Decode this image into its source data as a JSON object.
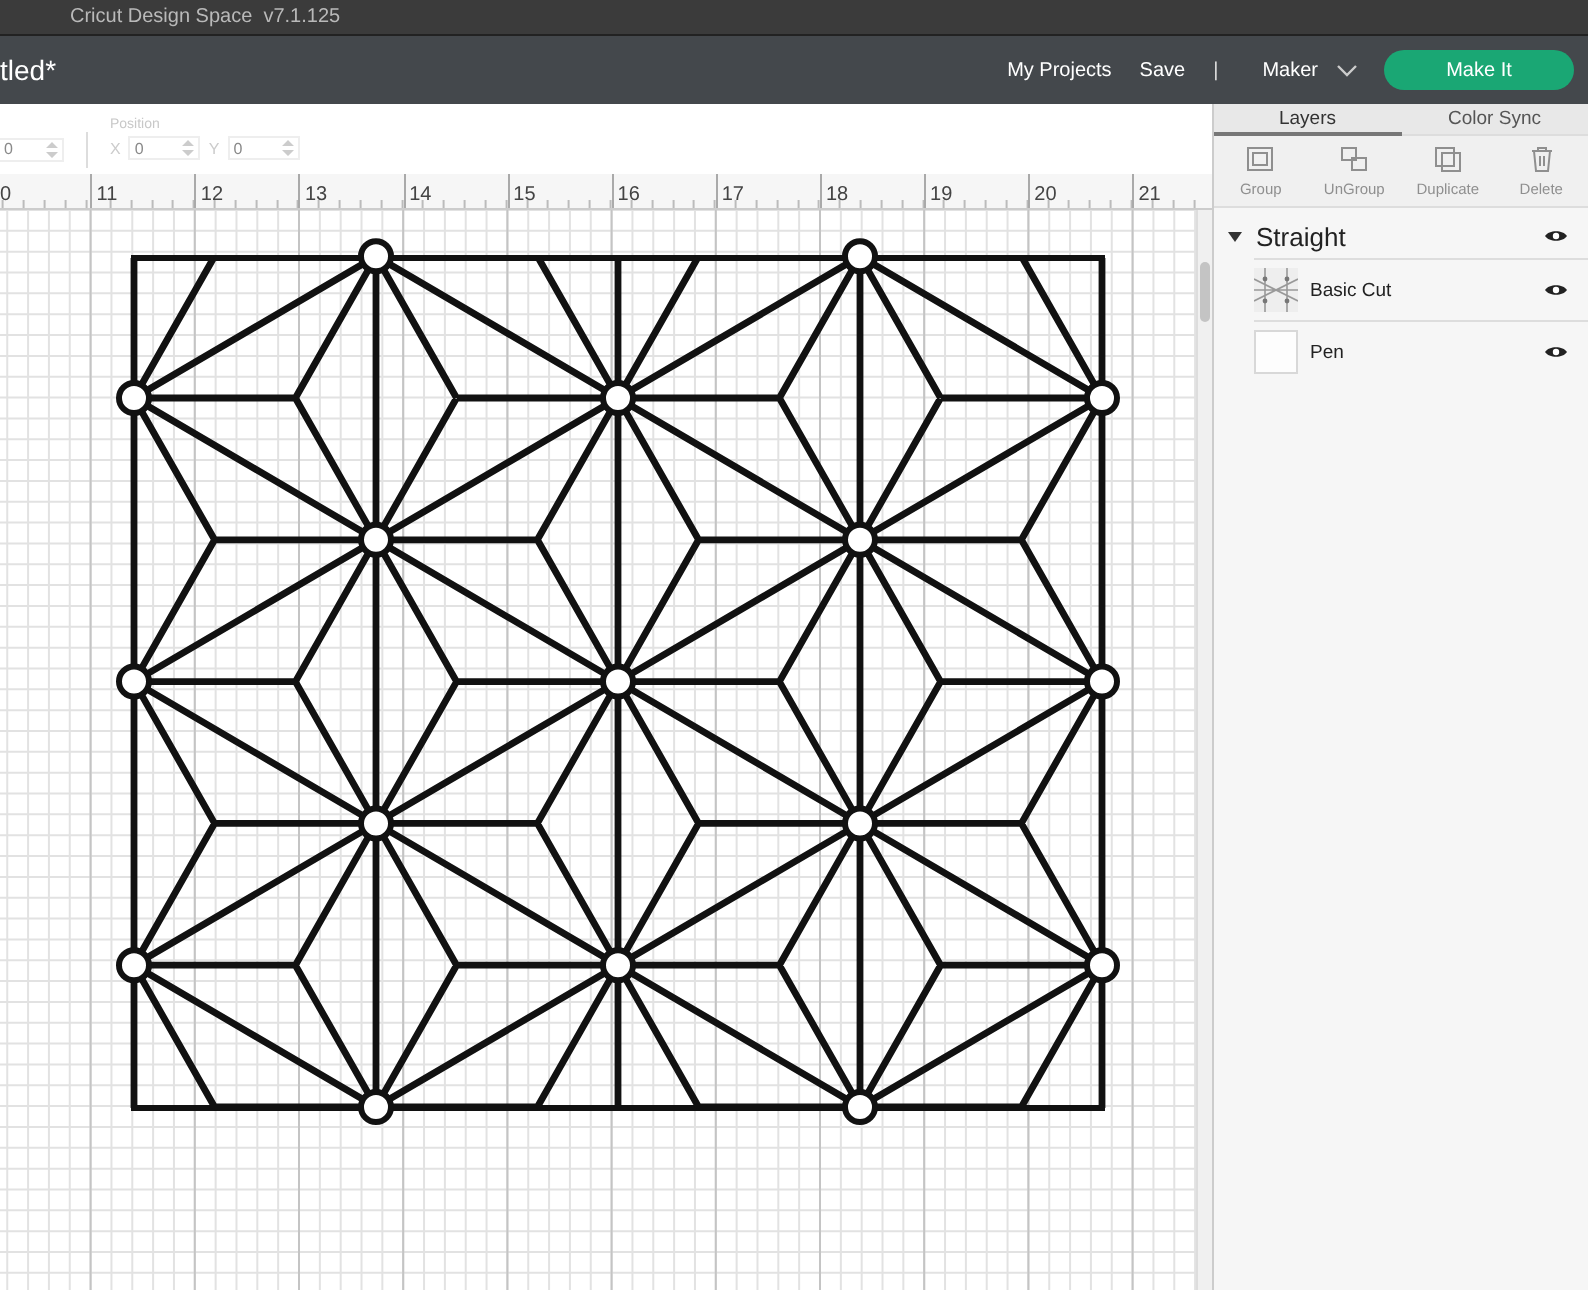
{
  "app_title": "Cricut Design Space  v7.1.125",
  "document_title": "tled*",
  "header": {
    "links": [
      "My Projects",
      "Save"
    ],
    "separator": "|",
    "machine": "Maker",
    "make_button": "Make It"
  },
  "toolbar": {
    "left_field": {
      "value": "0"
    },
    "position": {
      "label": "Position",
      "x": {
        "label": "X",
        "value": "0"
      },
      "y": {
        "label": "Y",
        "value": "0"
      }
    }
  },
  "ruler": [
    "0",
    "11",
    "12",
    "13",
    "14",
    "15",
    "16",
    "17",
    "18",
    "19",
    "20",
    "21"
  ],
  "panel": {
    "tabs": [
      {
        "label": "Layers",
        "selected": true
      },
      {
        "label": "Color Sync",
        "selected": false
      }
    ],
    "actions": [
      {
        "label": "Group",
        "kind": "group",
        "disabled": true
      },
      {
        "label": "UnGroup",
        "kind": "ungroup",
        "disabled": true
      },
      {
        "label": "Duplicate",
        "kind": "duplicate",
        "disabled": true
      },
      {
        "label": "Delete",
        "kind": "delete",
        "disabled": true
      }
    ],
    "layers": {
      "name": "Straight",
      "expanded": true,
      "visible": true,
      "children": [
        {
          "name": "Basic Cut",
          "kind": "pattern",
          "visible": true
        },
        {
          "name": "Pen",
          "kind": "blank",
          "visible": true
        }
      ]
    }
  }
}
